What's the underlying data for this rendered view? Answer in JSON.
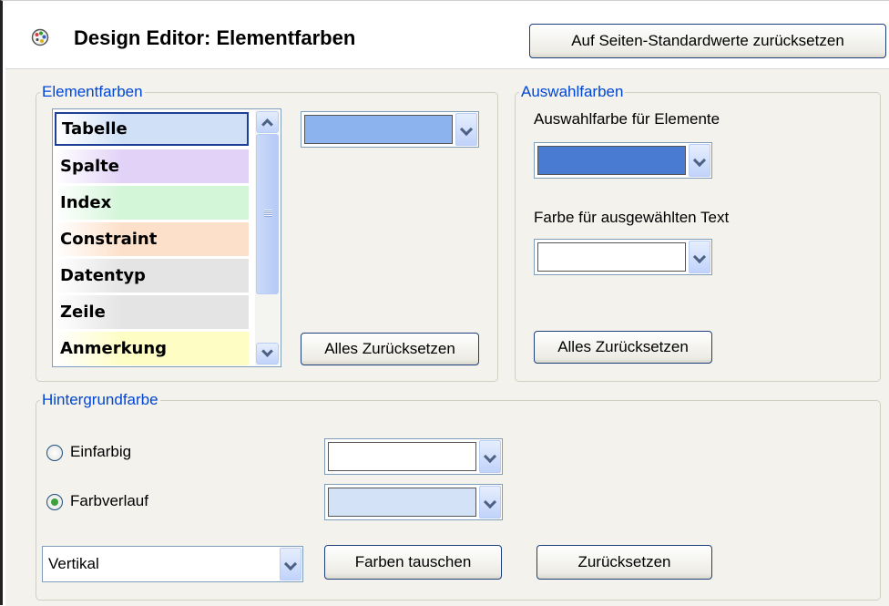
{
  "header": {
    "title": "Design Editor: Elementfarben",
    "reset_page_defaults_label": "Auf Seiten-Standardwerte zurücksetzen",
    "icon": "palette-icon"
  },
  "element_colors": {
    "legend": "Elementfarben",
    "items": [
      {
        "label": "Tabelle",
        "color": "#cfe0f7",
        "selected": true
      },
      {
        "label": "Spalte",
        "color": "#e2d2f7",
        "selected": false
      },
      {
        "label": "Index",
        "color": "#d3f5d8",
        "selected": false
      },
      {
        "label": "Constraint",
        "color": "#fde0c9",
        "selected": false
      },
      {
        "label": "Datentyp",
        "color": "#e4e4e4",
        "selected": false
      },
      {
        "label": "Zeile",
        "color": "#e4e4e4",
        "selected": false
      },
      {
        "label": "Anmerkung",
        "color": "#fdfdc4",
        "selected": false
      }
    ],
    "selected_color": "#8cb3ee",
    "reset_all_label": "Alles Zurücksetzen"
  },
  "selection_colors": {
    "legend": "Auswahlfarben",
    "element_label": "Auswahlfarbe für Elemente",
    "element_color": "#4a7bd2",
    "text_label": "Farbe für ausgewählten Text",
    "text_color": "#ffffff",
    "reset_all_label": "Alles Zurücksetzen"
  },
  "background": {
    "legend": "Hintergrundfarbe",
    "solid_label": "Einfarbig",
    "solid_checked": false,
    "solid_color": "#ffffff",
    "gradient_label": "Farbverlauf",
    "gradient_checked": true,
    "gradient_color": "#d4e2f8",
    "direction_value": "Vertikal",
    "swap_colors_label": "Farben tauschen",
    "reset_label": "Zurücksetzen"
  },
  "icons": {
    "dropdown_arrow": "chevron-down-icon",
    "scroll_up": "chevron-up-icon",
    "scroll_down": "chevron-down-icon"
  }
}
